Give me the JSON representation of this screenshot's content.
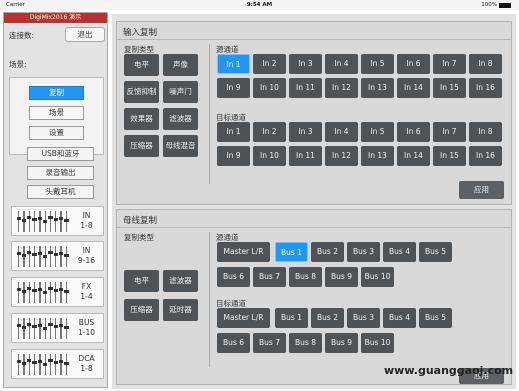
{
  "status_bar": {
    "carrier": "Carrier",
    "time": "9:54 AM",
    "battery": "100%"
  },
  "sidebar": {
    "app_title": "DigiMix2016 演示",
    "connection_label": "连接数:",
    "exit_label": "退出",
    "scene_label": "场景:",
    "nav": [
      {
        "label": "复制",
        "active": true
      },
      {
        "label": "场景",
        "active": false
      },
      {
        "label": "设置",
        "active": false
      }
    ],
    "utilities": [
      "USB和蓝牙",
      "录音输出",
      "头戴耳机"
    ],
    "fader_groups": [
      {
        "name": "IN",
        "range": "1-8"
      },
      {
        "name": "IN",
        "range": "9-16"
      },
      {
        "name": "FX",
        "range": "1-4"
      },
      {
        "name": "BUS",
        "range": "1-10"
      },
      {
        "name": "DCA",
        "range": "1-8"
      }
    ]
  },
  "input_copy": {
    "title": "输入复制",
    "copy_type_label": "复制类型",
    "copy_types": [
      "电平",
      "声像",
      "反馈抑制",
      "噪声门",
      "效果器",
      "滤波器",
      "压缩器",
      "母线混音"
    ],
    "source_label": "源通道",
    "source_channels": [
      "In 1",
      "In 2",
      "In 3",
      "In 4",
      "In 5",
      "In 6",
      "In 7",
      "In 8",
      "In 9",
      "In 10",
      "In 11",
      "In 12",
      "In 13",
      "In 14",
      "In 15",
      "In 16"
    ],
    "source_selected": "In 1",
    "target_label": "目标通道",
    "target_channels": [
      "In 1",
      "In 2",
      "In 3",
      "In 4",
      "In 5",
      "In 6",
      "In 7",
      "In 8",
      "In 9",
      "In 10",
      "In 11",
      "In 12",
      "In 13",
      "In 14",
      "In 15",
      "In 16"
    ],
    "apply_label": "应用"
  },
  "bus_copy": {
    "title": "母线复制",
    "copy_type_label": "复制类型",
    "copy_types": [
      "电平",
      "滤波器",
      "压缩器",
      "延时器"
    ],
    "source_label": "源通道",
    "source_channels": [
      "Master L/R",
      "Bus 1",
      "Bus 2",
      "Bus 3",
      "Bus 4",
      "Bus 5",
      "Bus 6",
      "Bus 7",
      "Bus 8",
      "Bus 9",
      "Bus 10"
    ],
    "source_selected": "Bus 1",
    "target_label": "目标通道",
    "target_channels": [
      "Master L/R",
      "Bus 1",
      "Bus 2",
      "Bus 3",
      "Bus 4",
      "Bus 5",
      "Bus 6",
      "Bus 7",
      "Bus 8",
      "Bus 9",
      "Bus 10"
    ],
    "apply_label": "应用"
  },
  "watermark": "www.guanggaoj.com"
}
